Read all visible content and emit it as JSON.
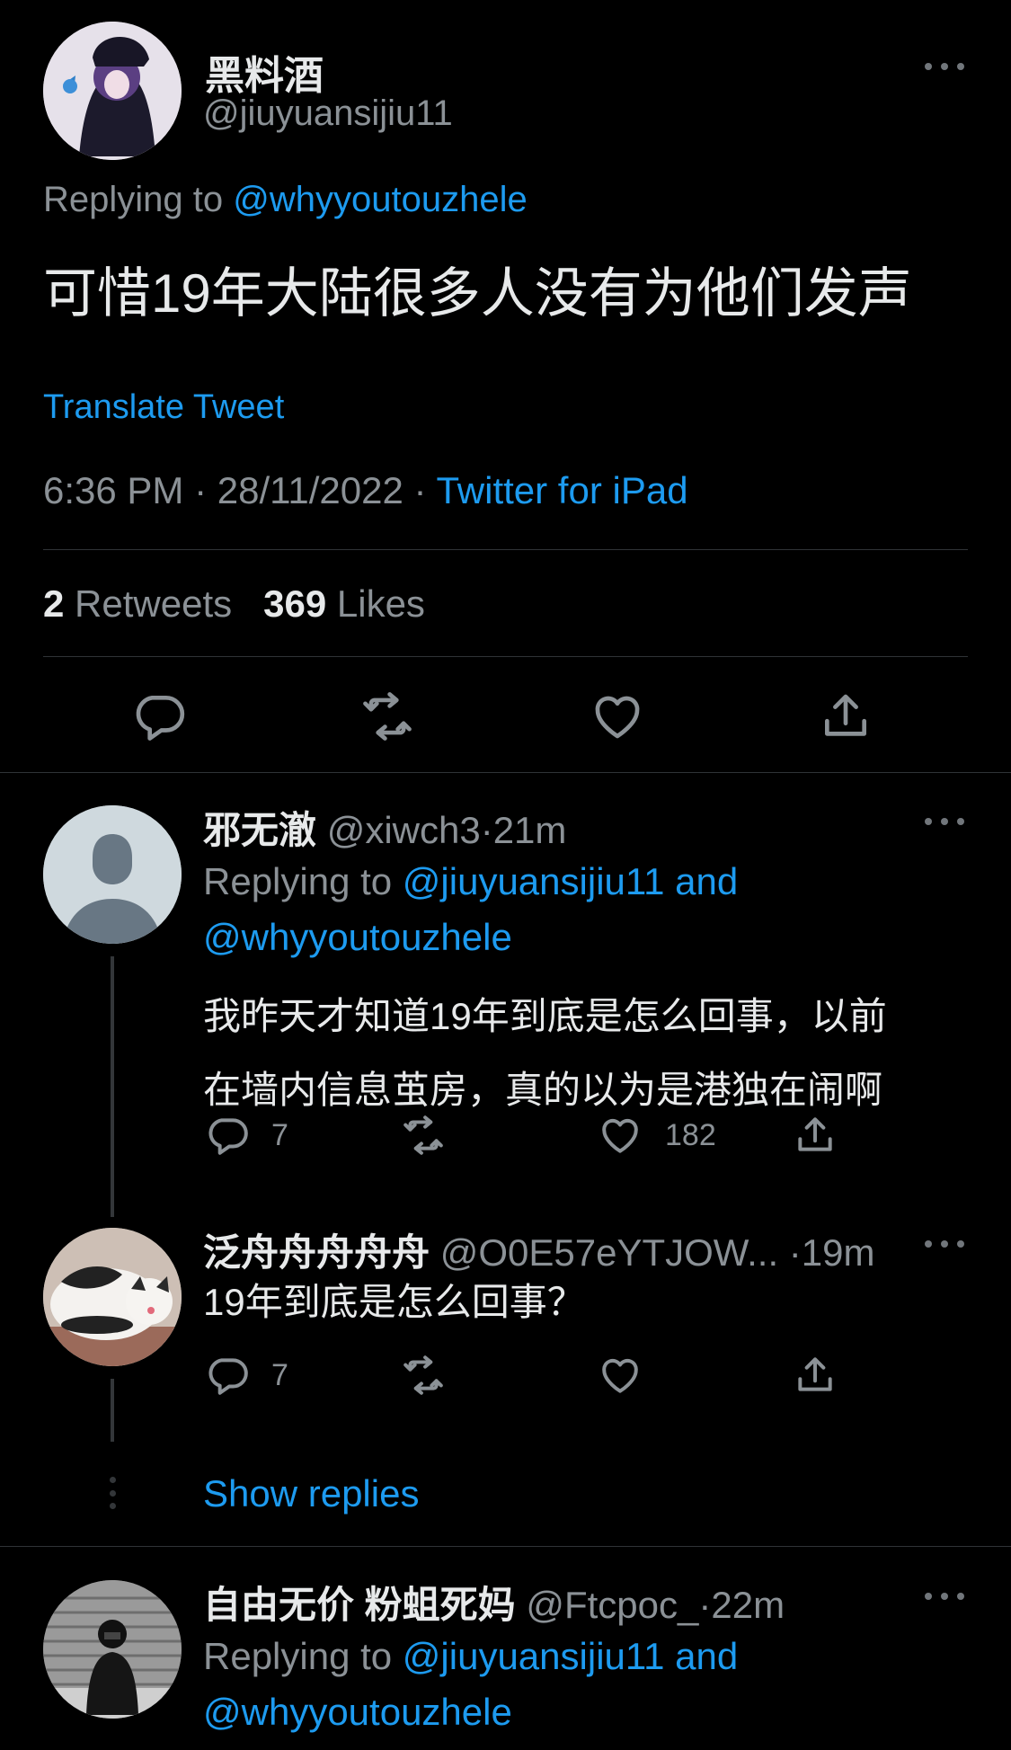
{
  "main_tweet": {
    "display_name": "黑料酒",
    "handle": "@jiuyuansijiu11",
    "replying_prefix": "Replying to ",
    "replying_to": "@whyyoutouzhele",
    "text": "可惜19年大陆很多人没有为他们发声",
    "translate_label": "Translate Tweet",
    "time": "6:36 PM",
    "date": "28/11/2022",
    "source": "Twitter for iPad",
    "retweets_count": "2",
    "retweets_label": "Retweets",
    "likes_count": "369",
    "likes_label": "Likes"
  },
  "replies": [
    {
      "display_name": "邪无澈",
      "handle": "@xiwch3",
      "time": "21m",
      "replying_prefix": "Replying to ",
      "replying_to_1": "@jiuyuansijiu11",
      "replying_and": " and",
      "replying_to_2": "@whyyoutouzhele",
      "text_line1": "我昨天才知道19年到底是怎么回事，以前",
      "text_line2": "在墙内信息茧房，真的以为是港独在闹啊",
      "reply_count": "7",
      "like_count": "182"
    },
    {
      "display_name": "泛舟舟舟舟舟",
      "handle": "@O0E57eYTJOW...",
      "time": "19m",
      "text": "19年到底是怎么回事？",
      "reply_count": "7"
    },
    {
      "display_name": "自由无价 粉蛆死妈",
      "handle": "@Ftcpoc_",
      "time": "22m",
      "replying_prefix": "Replying to ",
      "replying_to_1": "@jiuyuansijiu11",
      "replying_and": " and",
      "replying_to_2": "@whyyoutouzhele"
    }
  ],
  "show_replies_label": "Show replies",
  "separator": "·",
  "icons": [
    "reply-icon",
    "retweet-icon",
    "like-icon",
    "share-icon",
    "more-icon"
  ],
  "colors": {
    "background": "#000000",
    "accent": "#1d9bf0",
    "text": "#e7e9ea",
    "muted": "#8b9196",
    "divider": "#2f3336"
  }
}
